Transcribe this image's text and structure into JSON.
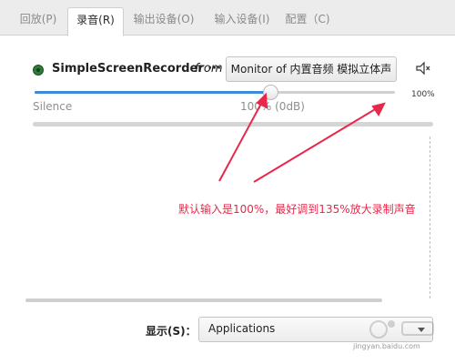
{
  "tabs": [
    {
      "label": "回放(P)"
    },
    {
      "label": "录音(R)"
    },
    {
      "label": "输出设备(O)"
    },
    {
      "label": "输入设备(I)"
    },
    {
      "label": "配置（C)"
    }
  ],
  "stream": {
    "app_name": "SimpleScreenRecorder ···",
    "from_label": "from",
    "device": "Monitor of 内置音频 模拟立体声",
    "volume_percent": 100,
    "volume_max_percent": 153,
    "right_label": "100%",
    "silence_label": "Silence",
    "center_label": "100% (0dB)"
  },
  "display": {
    "label": "显示(S)：",
    "value": "Applications"
  },
  "annotation": {
    "text": "默认输入是100%，最好调到135%放大录制声音",
    "color": "#e8284a"
  },
  "watermark": {
    "url_text": "jingyan.baidu.com"
  },
  "colors": {
    "accent": "#3a8ad6",
    "status": "#2d7d3a"
  }
}
